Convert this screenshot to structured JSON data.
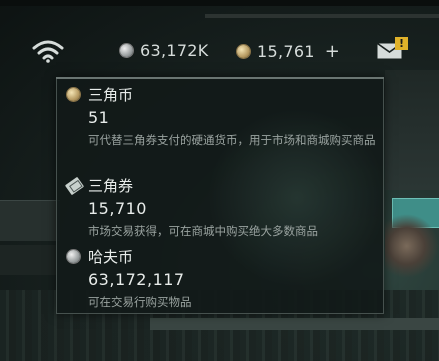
{
  "hud": {
    "haf_coin_value": "63,172K",
    "triangle_coin_value": "15,761",
    "plus_label": "+",
    "mail_alert": "!"
  },
  "tooltip": {
    "items": [
      {
        "name": "三角币",
        "value": "51",
        "desc": "可代替三角券支付的硬通货币，用于市场和商城购买商品",
        "icon": "triangle-coin-icon"
      },
      {
        "name": "三角券",
        "value": "15,710",
        "desc": "市场交易获得，可在商城中购买绝大多数商品",
        "icon": "triangle-ticket-icon"
      },
      {
        "name": "哈夫币",
        "value": "63,172,117",
        "desc": "可在交易行购买物品",
        "icon": "haf-coin-icon"
      }
    ]
  },
  "colors": {
    "alert": "#e0b22a",
    "text": "#e8ecea",
    "muted": "#9aa3a0"
  }
}
